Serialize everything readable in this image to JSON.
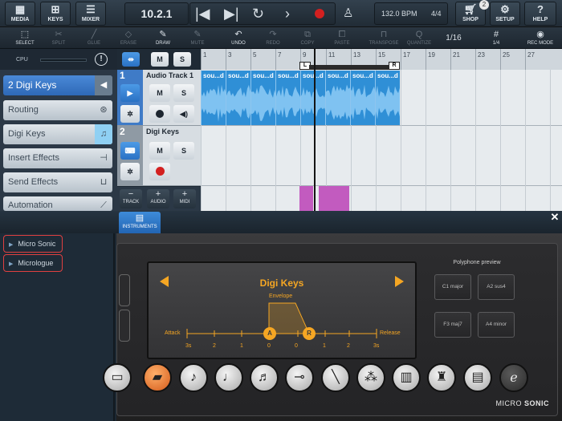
{
  "topbar": {
    "media": "MEDIA",
    "keys": "KEYS",
    "mixer": "MIXER",
    "position": "10.2.1",
    "bpm": "132.0 BPM",
    "time_sig": "4/4",
    "shop": "SHOP",
    "shop_badge": "2",
    "setup": "SETUP",
    "help": "HELP"
  },
  "toolbar2": {
    "select": "SELECT",
    "split": "SPLIT",
    "glue": "GLUE",
    "erase": "ERASE",
    "draw": "DRAW",
    "mute": "MUTE",
    "undo": "UNDO",
    "redo": "REDO",
    "copy": "COPY",
    "paste": "PASTE",
    "transpose": "TRANSPOSE",
    "quantize": "QUANTIZE",
    "quantize_value": "1/16",
    "snap": "1/4",
    "rec_mode": "REC MODE"
  },
  "inspector": {
    "cpu_label": "CPU",
    "selected_num": "2",
    "selected_name": "Digi Keys",
    "items": [
      {
        "label": "Routing"
      },
      {
        "label": "Digi Keys"
      },
      {
        "label": "Insert Effects"
      },
      {
        "label": "Send Effects"
      },
      {
        "label": "Automation"
      }
    ]
  },
  "ruler": {
    "bars": [
      "1",
      "3",
      "5",
      "7",
      "9",
      "11",
      "13",
      "15",
      "17",
      "19",
      "21",
      "23",
      "25",
      "27"
    ],
    "loop_left": "L",
    "loop_right": "R"
  },
  "tracks": [
    {
      "num": "1",
      "name": "Audio Track 1",
      "clip_label": "sou...d"
    },
    {
      "num": "2",
      "name": "Digi Keys"
    }
  ],
  "track_buttons": {
    "mute": "M",
    "solo": "S",
    "track": "TRACK",
    "audio": "AUDIO",
    "midi": "MIDI"
  },
  "instruments": {
    "tab_label": "INSTRUMENTS",
    "browser": [
      "Micro Sonic",
      "Micrologue"
    ],
    "preset_name": "Digi Keys",
    "envelope": "Envelope",
    "attack": "Attack",
    "release": "Release",
    "scale": [
      "3s",
      "2",
      "1",
      "0",
      "0",
      "1",
      "2",
      "3s"
    ],
    "knob_a": "A",
    "knob_r": "R",
    "polyphone_title": "Polyphone preview",
    "chords": [
      "C1 major",
      "A2 sus4",
      "F3 maj7",
      "A4 minor"
    ],
    "brand_a": "MICRO",
    "brand_b": "SONIC"
  },
  "colors": {
    "accent": "#f5a623",
    "selection_blue": "#3e7cc9",
    "audio_clip": "#2f8fd6",
    "midi_clip": "#c25bbf",
    "record": "#d32020"
  }
}
